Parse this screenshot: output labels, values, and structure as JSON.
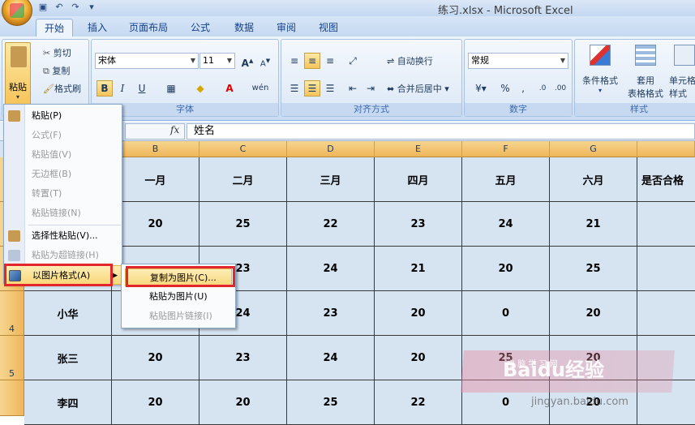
{
  "window": {
    "title": "练习.xlsx - Microsoft Excel"
  },
  "tabs": [
    "开始",
    "插入",
    "页面布局",
    "公式",
    "数据",
    "审阅",
    "视图"
  ],
  "clipboard": {
    "paste": "粘贴",
    "cut": "剪切",
    "copy": "复制",
    "format_painter": "格式刷"
  },
  "font": {
    "name": "宋体",
    "size": "11",
    "group_label": "字体"
  },
  "alignment": {
    "wrap_text": "自动换行",
    "merge_center": "合并后居中",
    "group_label": "对齐方式"
  },
  "number": {
    "format": "常规",
    "group_label": "数字",
    "percent": "%",
    "comma": ","
  },
  "styles": {
    "conditional": "条件格式",
    "table_format_1": "套用",
    "table_format_2": "表格格式",
    "cell_style_1": "单元格",
    "cell_style_2": "样式",
    "group_label": "样式"
  },
  "formula_bar": {
    "fx": "fx",
    "value": "姓名"
  },
  "sheet": {
    "columns": [
      "B",
      "C",
      "D",
      "E",
      "F",
      "G"
    ],
    "rows": [
      "",
      "",
      "",
      "4",
      "5",
      ""
    ],
    "header_row": [
      "一月",
      "二月",
      "三月",
      "四月",
      "五月",
      "六月",
      "是否合格"
    ],
    "data": [
      {
        "name": "",
        "values": [
          "20",
          "25",
          "22",
          "23",
          "24",
          "21"
        ]
      },
      {
        "name": "",
        "values": [
          "",
          "23",
          "24",
          "21",
          "20",
          "25"
        ]
      },
      {
        "name": "小华",
        "values": [
          "",
          "24",
          "23",
          "20",
          "0",
          "20"
        ]
      },
      {
        "name": "张三",
        "values": [
          "20",
          "23",
          "24",
          "20",
          "25",
          "20"
        ]
      },
      {
        "name": "李四",
        "values": [
          "20",
          "20",
          "25",
          "22",
          "0",
          "20"
        ]
      }
    ]
  },
  "paste_menu": {
    "items": [
      "粘贴(P)",
      "公式(F)",
      "粘贴值(V)",
      "无边框(B)",
      "转置(T)",
      "粘贴链接(N)",
      "选择性粘贴(V)...",
      "粘贴为超链接(H)",
      "以图片格式(A)"
    ]
  },
  "picture_submenu": {
    "items": [
      "复制为图片(C)...",
      "粘贴为图片(U)",
      "粘贴图片链接(I)"
    ]
  },
  "watermark": {
    "main": "Baidu经验",
    "sub": "jingyan.baidu.com",
    "small": "电 脑 学 习 网"
  }
}
